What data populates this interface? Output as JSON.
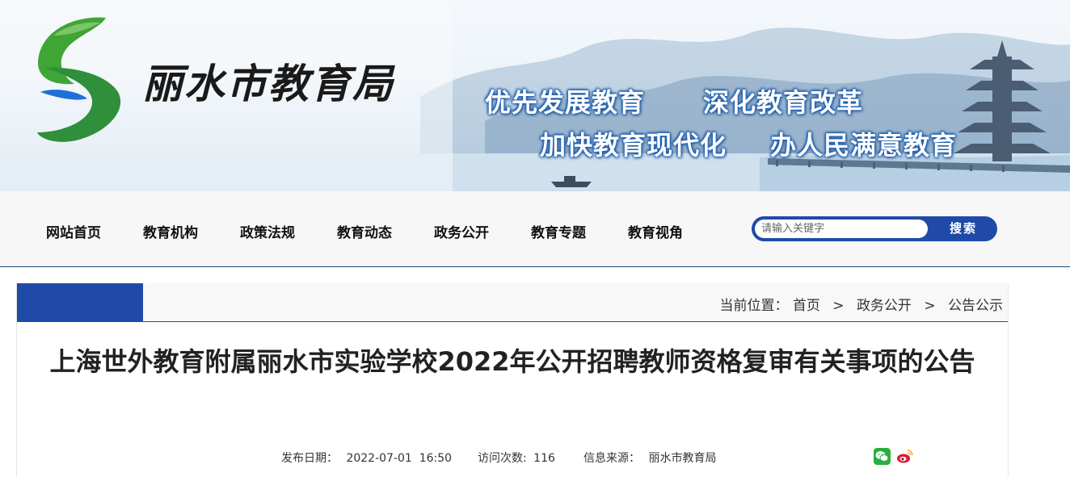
{
  "header": {
    "site_name": "丽水市教育局",
    "slogans": [
      "优先发展教育",
      "深化教育改革",
      "加快教育现代化",
      "办人民满意教育"
    ],
    "colors": {
      "logo_green": "#3fa535",
      "logo_blue": "#1f6fd8",
      "slogan_outline": "#1f5fae"
    }
  },
  "nav": {
    "items": [
      "网站首页",
      "教育机构",
      "政策法规",
      "教育动态",
      "政务公开",
      "教育专题",
      "教育视角"
    ],
    "search_placeholder": "请输入关键字",
    "search_button": "搜索",
    "accent_color": "#1f4aa8"
  },
  "breadcrumb": {
    "prefix": "当前位置：",
    "items": [
      "首页",
      "政务公开",
      "公告公示"
    ],
    "separator": ">"
  },
  "article": {
    "title": "上海世外教育附属丽水市实验学校2022年公开招聘教师资格复审有关事项的公告",
    "publish_label": "发布日期：",
    "publish_date": "2022-07-01  16:50",
    "visits_label": "访问次数:",
    "visits": "116",
    "source_label": "信息来源：",
    "source": "丽水市教育局"
  },
  "share": {
    "icons": [
      "wechat-icon",
      "weibo-icon"
    ]
  }
}
